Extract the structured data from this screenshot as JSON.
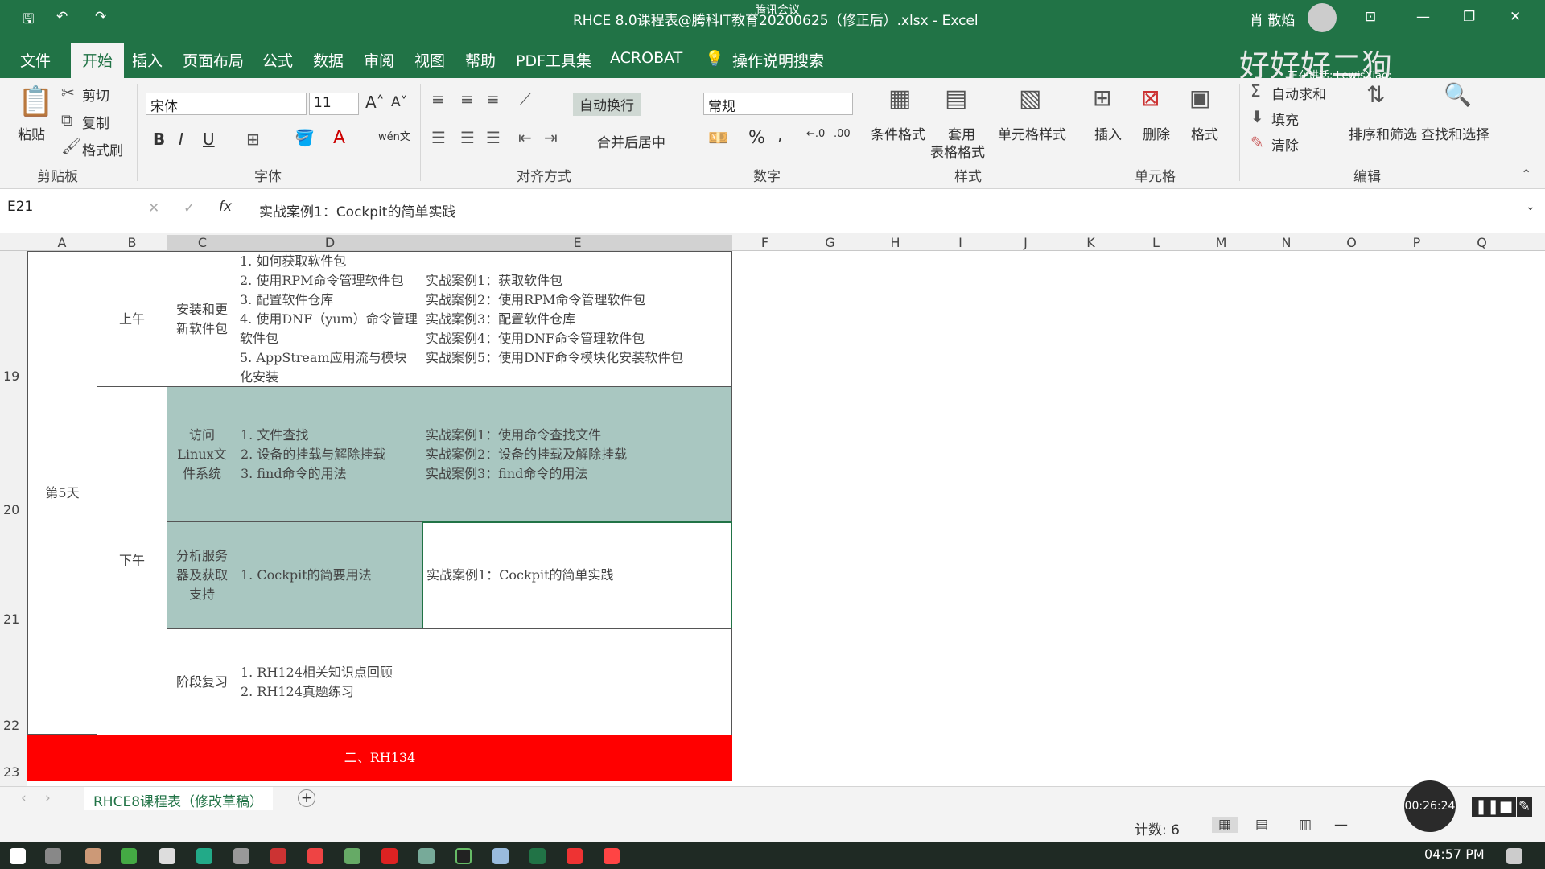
{
  "titlebar": {
    "title": "RHCE 8.0课程表@腾科IT教育20200625（修正后）.xlsx  -  Excel",
    "meeting": "腾讯会议",
    "user": "肖 散焰",
    "speaking": "正在讲话: LewisXiao;",
    "watermark": "好好好二狗"
  },
  "tabs": [
    "文件",
    "开始",
    "插入",
    "页面布局",
    "公式",
    "数据",
    "审阅",
    "视图",
    "帮助",
    "PDF工具集",
    "ACROBAT"
  ],
  "active_tab": "开始",
  "search": "操作说明搜索",
  "ribbon": {
    "clipboard": {
      "paste": "粘贴",
      "cut": "剪切",
      "copy": "复制",
      "format_painter": "格式刷",
      "label": "剪贴板"
    },
    "font": {
      "name": "宋体",
      "size": "11",
      "bold": "B",
      "italic": "I",
      "underline": "U",
      "label": "字体"
    },
    "align": {
      "wrap": "自动换行",
      "merge": "合并后居中",
      "label": "对齐方式"
    },
    "number": {
      "format": "常规",
      "percent": "%",
      "comma": ",",
      "label": "数字"
    },
    "styles": {
      "cond": "条件格式",
      "table_fmt1": "套用",
      "table_fmt2": "表格格式",
      "cell_style": "单元格样式",
      "label": "样式"
    },
    "cells": {
      "insert": "插入",
      "delete": "删除",
      "format": "格式",
      "label": "单元格"
    },
    "edit": {
      "autosum": "自动求和",
      "fill": "填充",
      "clear": "清除",
      "sort": "排序和筛选",
      "find": "查找和选择",
      "label": "编辑"
    }
  },
  "formula_bar": {
    "name_box": "E21",
    "fx": "fx",
    "content": "实战案例1：Cockpit的简单实践"
  },
  "columns": [
    "A",
    "B",
    "C",
    "D",
    "E",
    "F",
    "G",
    "H",
    "I",
    "J",
    "K",
    "L",
    "M",
    "N",
    "O",
    "P",
    "Q"
  ],
  "rows": [
    "19",
    "20",
    "21",
    "22",
    "23"
  ],
  "cells": {
    "day": "第5天",
    "am": "上午",
    "pm": "下午",
    "r19c": "安装和更新软件包",
    "r19d": [
      "1. 如何获取软件包",
      "2. 使用RPM命令管理软件包",
      "3. 配置软件仓库",
      "4. 使用DNF（yum）命令管理软件包",
      "5. AppStream应用流与模块化安装"
    ],
    "r19e": [
      "实战案例1：获取软件包",
      "实战案例2：使用RPM命令管理软件包",
      "实战案例3：配置软件仓库",
      "实战案例4：使用DNF命令管理软件包",
      "实战案例5：使用DNF命令模块化安装软件包"
    ],
    "r20c": "访问Linux文件系统",
    "r20d": [
      "1. 文件查找",
      "2. 设备的挂载与解除挂载",
      "3. find命令的用法"
    ],
    "r20e": [
      "实战案例1：使用命令查找文件",
      "实战案例2：设备的挂载及解除挂载",
      "实战案例3：find命令的用法"
    ],
    "r21c": "分析服务器及获取支持",
    "r21d": "1. Cockpit的简要用法",
    "r21e": "实战案例1：Cockpit的简单实践",
    "r22c": "阶段复习",
    "r22d": [
      "1. RH124相关知识点回顾",
      "2. RH124真题练习"
    ],
    "r23": "二、RH134"
  },
  "sheet_tab": "RHCE8课程表（修改草稿）",
  "status": {
    "count": "计数: 6"
  },
  "recorder": {
    "time": "00:26:24"
  },
  "clock": "04:57 PM",
  "colors": {
    "excel_green": "#217346",
    "selection": "#a9c7c1",
    "red_bar": "#ff0000"
  }
}
